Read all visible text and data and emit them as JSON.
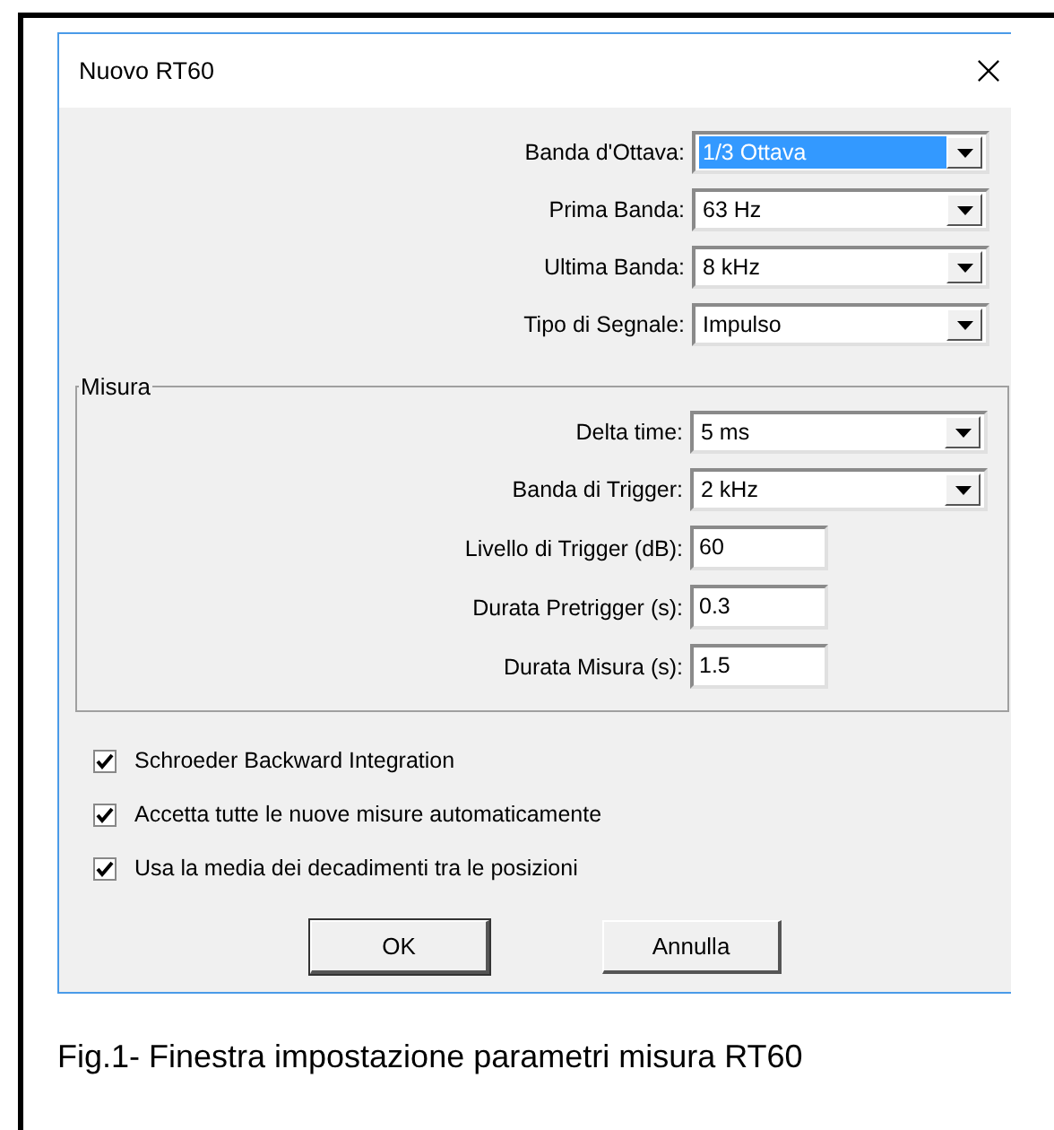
{
  "dialog": {
    "title": "Nuovo RT60",
    "fields": [
      {
        "kind": "combo",
        "label": "Banda d'Ottava:",
        "value": "1/3 Ottava",
        "highlighted": true
      },
      {
        "kind": "combo",
        "label": "Prima Banda:",
        "value": "63 Hz",
        "highlighted": false
      },
      {
        "kind": "combo",
        "label": "Ultima Banda:",
        "value": "8 kHz",
        "highlighted": false
      },
      {
        "kind": "combo",
        "label": "Tipo di Segnale:",
        "value": "Impulso",
        "highlighted": false
      }
    ],
    "group": {
      "title": "Misura",
      "fields": [
        {
          "kind": "combo",
          "label": "Delta time:",
          "value": "5 ms",
          "highlighted": false
        },
        {
          "kind": "combo",
          "label": "Banda di Trigger:",
          "value": "2 kHz",
          "highlighted": false
        },
        {
          "kind": "text",
          "label": "Livello di Trigger (dB):",
          "value": "60"
        },
        {
          "kind": "text",
          "label": "Durata Pretrigger (s):",
          "value": "0.3"
        },
        {
          "kind": "text",
          "label": "Durata Misura (s):",
          "value": "1.5"
        }
      ]
    },
    "checkboxes": [
      {
        "label": "Schroeder Backward Integration",
        "checked": true
      },
      {
        "label": "Accetta tutte le nuove misure automaticamente",
        "checked": true
      },
      {
        "label": "Usa la media dei decadimenti tra le posizioni",
        "checked": true
      }
    ],
    "buttons": [
      {
        "label": "OK",
        "default": true
      },
      {
        "label": "Annulla",
        "default": false
      }
    ]
  },
  "caption": "Fig.1- Finestra impostazione parametri misura RT60"
}
